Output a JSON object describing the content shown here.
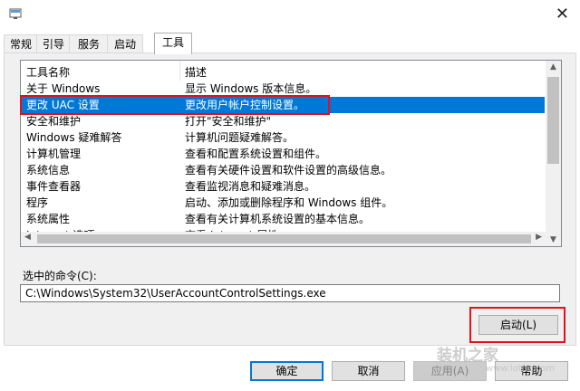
{
  "tabs": [
    "常规",
    "引导",
    "服务",
    "启动",
    "工具"
  ],
  "list": {
    "col1_header": "工具名称",
    "col2_header": "描述",
    "rows": [
      {
        "name": "关于 Windows",
        "desc": "显示 Windows 版本信息。"
      },
      {
        "name": "更改 UAC 设置",
        "desc": "更改用户帐户控制设置。",
        "selected": true
      },
      {
        "name": "安全和维护",
        "desc": "打开\"安全和维护\""
      },
      {
        "name": "Windows 疑难解答",
        "desc": "计算机问题疑难解答。"
      },
      {
        "name": "计算机管理",
        "desc": "查看和配置系统设置和组件。"
      },
      {
        "name": "系统信息",
        "desc": "查看有关硬件设置和软件设置的高级信息。"
      },
      {
        "name": "事件查看器",
        "desc": "查看监视消息和疑难消息。"
      },
      {
        "name": "程序",
        "desc": "启动、添加或删除程序和 Windows 组件。"
      },
      {
        "name": "系统属性",
        "desc": "查看有关计算机系统设置的基本信息。"
      },
      {
        "name": "Internet 选项",
        "desc": "查看 Internet 属性。"
      }
    ]
  },
  "command": {
    "label": "选中的命令(C):",
    "value": "C:\\Windows\\System32\\UserAccountControlSettings.exe"
  },
  "buttons": {
    "launch": "启动(L)",
    "ok": "确定",
    "cancel": "取消",
    "apply": "应用(A)",
    "help": "帮助"
  },
  "titlebar": {
    "close_glyph": "✕"
  },
  "watermark": {
    "main": "装机之家",
    "sub": "www.lotpc.com"
  },
  "colors": {
    "selection": "#0078d7",
    "highlight_box": "#e0121a"
  }
}
